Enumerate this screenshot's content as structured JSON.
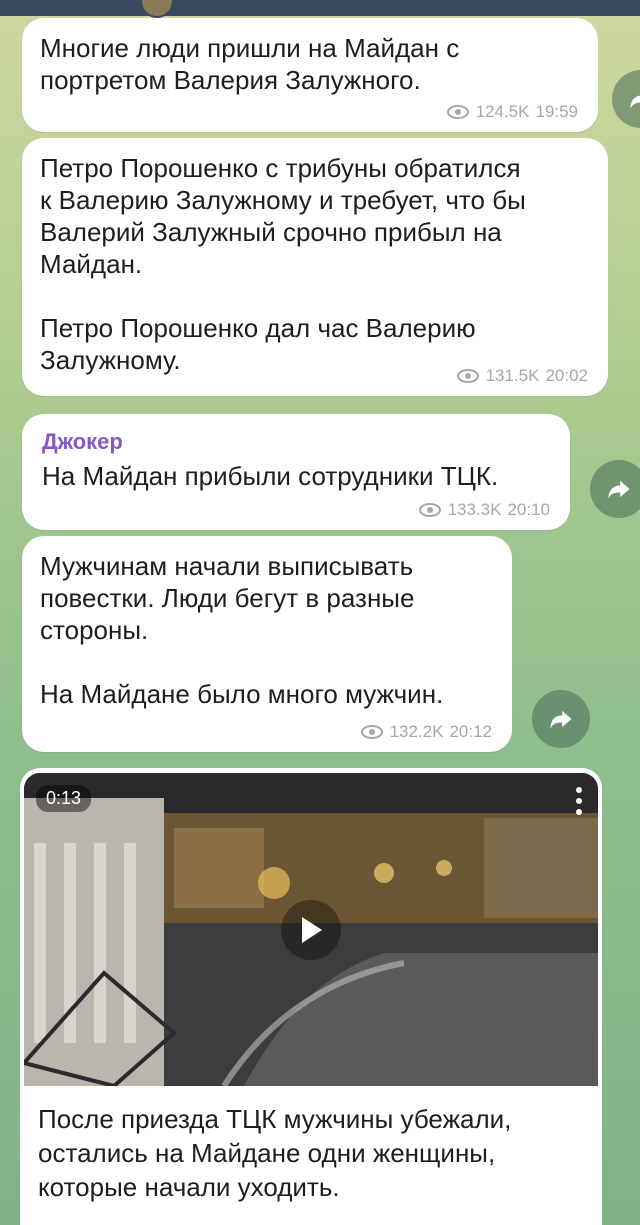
{
  "messages": [
    {
      "text": "Многие люди пришли на Майдан с\nпортретом Валерия Залужного.",
      "views": "124.5K",
      "time": "19:59"
    },
    {
      "text": "Петро Порошенко с трибуны обратился\nк Валерию Залужному и требует, что бы\nВалерий Залужный срочно прибыл на\nМайдан.\n\nПетро Порошенко дал час Валерию\nЗалужному.",
      "views": "131.5K",
      "time": "20:02"
    },
    {
      "sender": "Джокер",
      "text": "На Майдан прибыли сотрудники ТЦК.",
      "views": "133.3K",
      "time": "20:10"
    },
    {
      "text": "Мужчинам начали выписывать\nповестки. Люди бегут в разные\nстороны.\n\nНа Майдане было много мужчин.",
      "views": "132.2K",
      "time": "20:12"
    },
    {
      "video_duration": "0:13",
      "text": "После приезда ТЦК мужчины убежали,\nостались на Майдане одни женщины,\nкоторые начали уходить."
    }
  ],
  "colors": {
    "sender": "#8757c7",
    "meta": "#a3a8ad",
    "bubble": "#ffffff",
    "header": "#3a4a5c"
  },
  "icons": {
    "views": "eye-icon",
    "forward": "forward-arrow-icon",
    "play": "play-icon",
    "menu": "more-vertical-icon"
  }
}
